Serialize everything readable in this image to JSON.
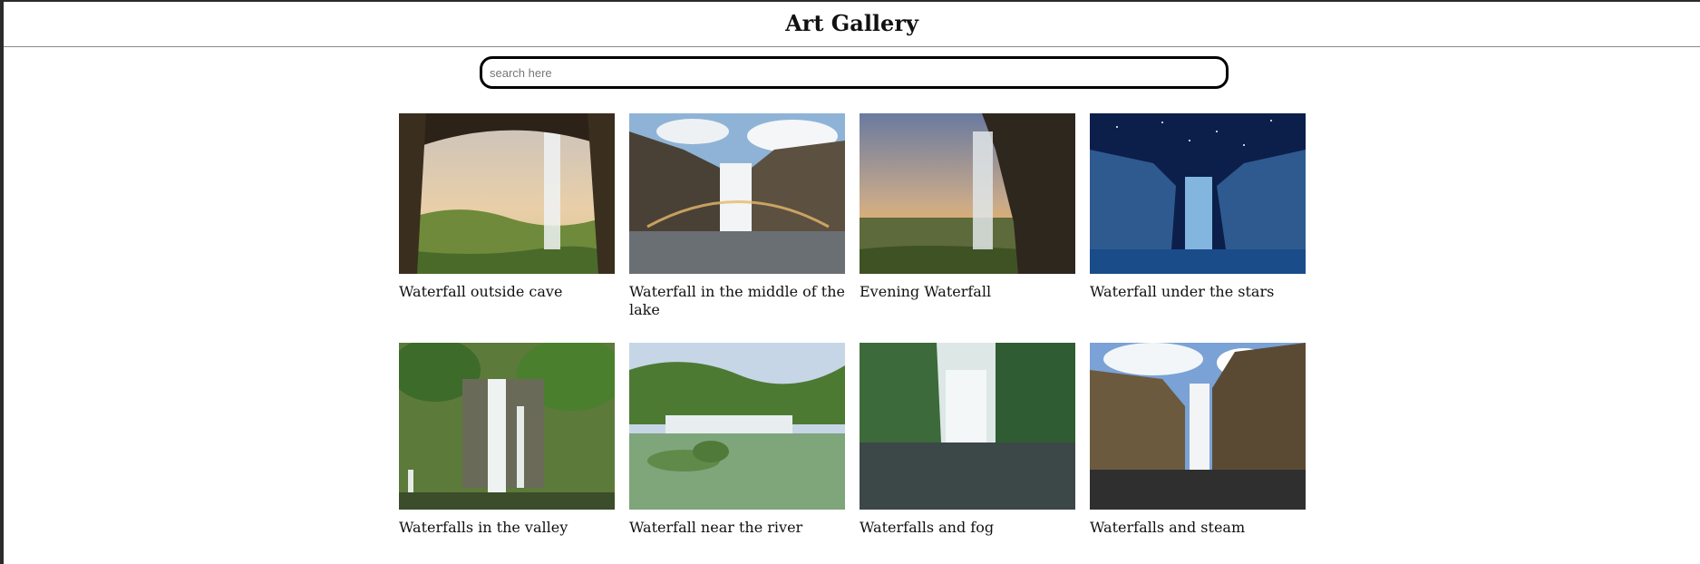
{
  "header": {
    "title": "Art Gallery"
  },
  "search": {
    "placeholder": "search here",
    "value": ""
  },
  "gallery": {
    "items": [
      {
        "caption": "Waterfall outside cave"
      },
      {
        "caption": "Waterfall in the middle of the lake"
      },
      {
        "caption": "Evening Waterfall"
      },
      {
        "caption": "Waterfall under the stars"
      },
      {
        "caption": "Waterfalls in the valley"
      },
      {
        "caption": "Waterfall near the river"
      },
      {
        "caption": "Waterfalls and fog"
      },
      {
        "caption": "Waterfalls and steam"
      }
    ]
  }
}
